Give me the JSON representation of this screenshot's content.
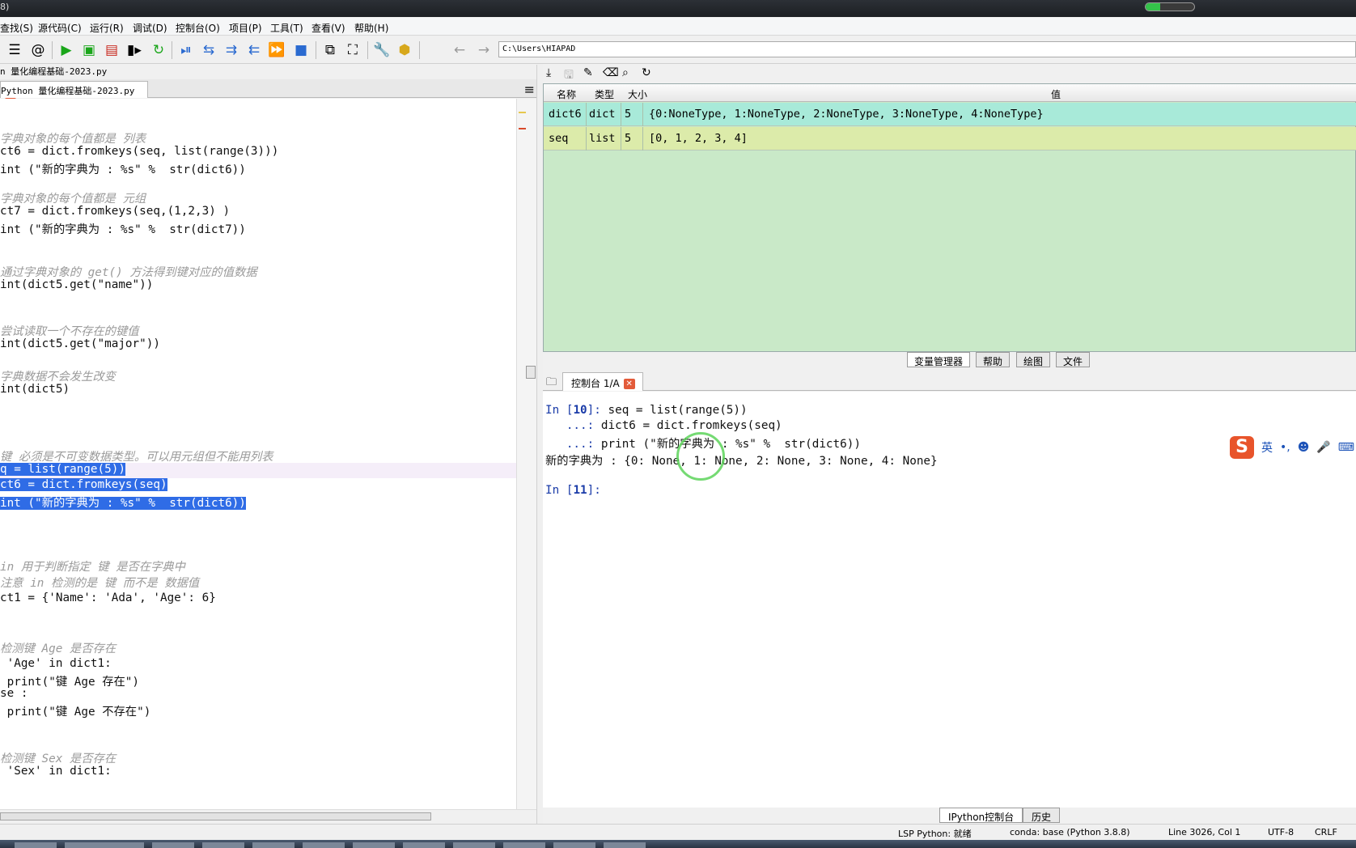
{
  "window": {
    "title": "8)",
    "progress_fraction": 0.3
  },
  "menu": [
    "查找(S)",
    "源代码(C)",
    "运行(R)",
    "调试(D)",
    "控制台(O)",
    "项目(P)",
    "工具(T)",
    "查看(V)",
    "帮助(H)"
  ],
  "toolbar": {
    "path": "C:\\Users\\HIAPAD",
    "icons": [
      "list-icon",
      "at-icon",
      "run-icon",
      "run-cell-icon",
      "run-cell-advance-icon",
      "run-selection-icon",
      "rerun-icon",
      "debug-icon",
      "step-icon",
      "step-into-icon",
      "step-return-icon",
      "continue-icon",
      "stop-icon",
      "maximize-pane-icon",
      "fullscreen-icon",
      "wrench-icon",
      "python-path-icon",
      "back-icon",
      "forward-icon"
    ]
  },
  "editor": {
    "file_label": "n 量化编程基础-2023.py",
    "tab_label": "Python 量化编程基础-2023.py",
    "lines": [
      "",
      "字典对象的每个值都是 列表",
      "ct6 = dict.fromkeys(seq, list(range(3)))",
      "int (\"新的字典为 : %s\" %  str(dict6))",
      "",
      "字典对象的每个值都是 元组",
      "ct7 = dict.fromkeys(seq,(1,2,3) )",
      "int (\"新的字典为 : %s\" %  str(dict7))",
      "",
      "",
      "通过字典对象的 get() 方法得到键对应的值数据",
      "int(dict5.get(\"name\"))",
      "",
      "",
      "尝试读取一个不存在的键值",
      "int(dict5.get(\"major\"))",
      "",
      "字典数据不会发生改变",
      "int(dict5)",
      "",
      "",
      "",
      "键 必须是不可变数据类型。可以用元组但不能用列表",
      "q = list(range(5))",
      "ct6 = dict.fromkeys(seq)",
      "int (\"新的字典为 : %s\" %  str(dict6))",
      "",
      "",
      "",
      "in 用于判断指定 键 是否在字典中",
      "注意 in 检测的是 键 而不是 数据值",
      "ct1 = {'Name': 'Ada', 'Age': 6}",
      "",
      "",
      "检测键 Age 是否存在",
      " 'Age' in dict1:",
      " print(\"键 Age 存在\")",
      "se :",
      " print(\"键 Age 不存在\")",
      "",
      "",
      "检测键 Sex 是否存在",
      " 'Sex' in dict1:"
    ]
  },
  "variable_explorer": {
    "headers": {
      "name": "名称",
      "type": "类型",
      "size": "大小",
      "value": "值"
    },
    "rows": [
      {
        "name": "dict6",
        "type": "dict",
        "size": "5",
        "value": "{0:NoneType, 1:NoneType, 2:NoneType, 3:NoneType, 4:NoneType}",
        "color": "#a8ead9"
      },
      {
        "name": "seq",
        "type": "list",
        "size": "5",
        "value": "[0, 1, 2, 3, 4]",
        "color": "#dcebaa"
      }
    ],
    "tabs": [
      "变量管理器",
      "帮助",
      "绘图",
      "文件"
    ]
  },
  "console": {
    "tab_label": "控制台 1/A",
    "prompt_in10": "In [",
    "num10": "10",
    "prompt_close": "]:",
    "line1_code": " seq = list(range(5))",
    "cont": "   ...:",
    "line2_code": " dict6 = dict.fromkeys(seq)",
    "line3_code": " print (\"新的字典为 : %s\" %  str(dict6))",
    "output": "新的字典为 : {0: None, 1: None, 2: None, 3: None, 4: None}",
    "num11": "11",
    "bottom_tabs": [
      "IPython控制台",
      "历史"
    ]
  },
  "ime": {
    "logo": "S",
    "mode": "英",
    "punct": "•,",
    "emoji": "☻",
    "mic": "🎤",
    "keyboard": "⌨"
  },
  "status": {
    "lsp": "LSP Python: 就绪",
    "conda": "conda: base (Python 3.8.8)",
    "position": "Line 3026, Col 1",
    "encoding": "UTF-8",
    "eol": "CRLF"
  }
}
